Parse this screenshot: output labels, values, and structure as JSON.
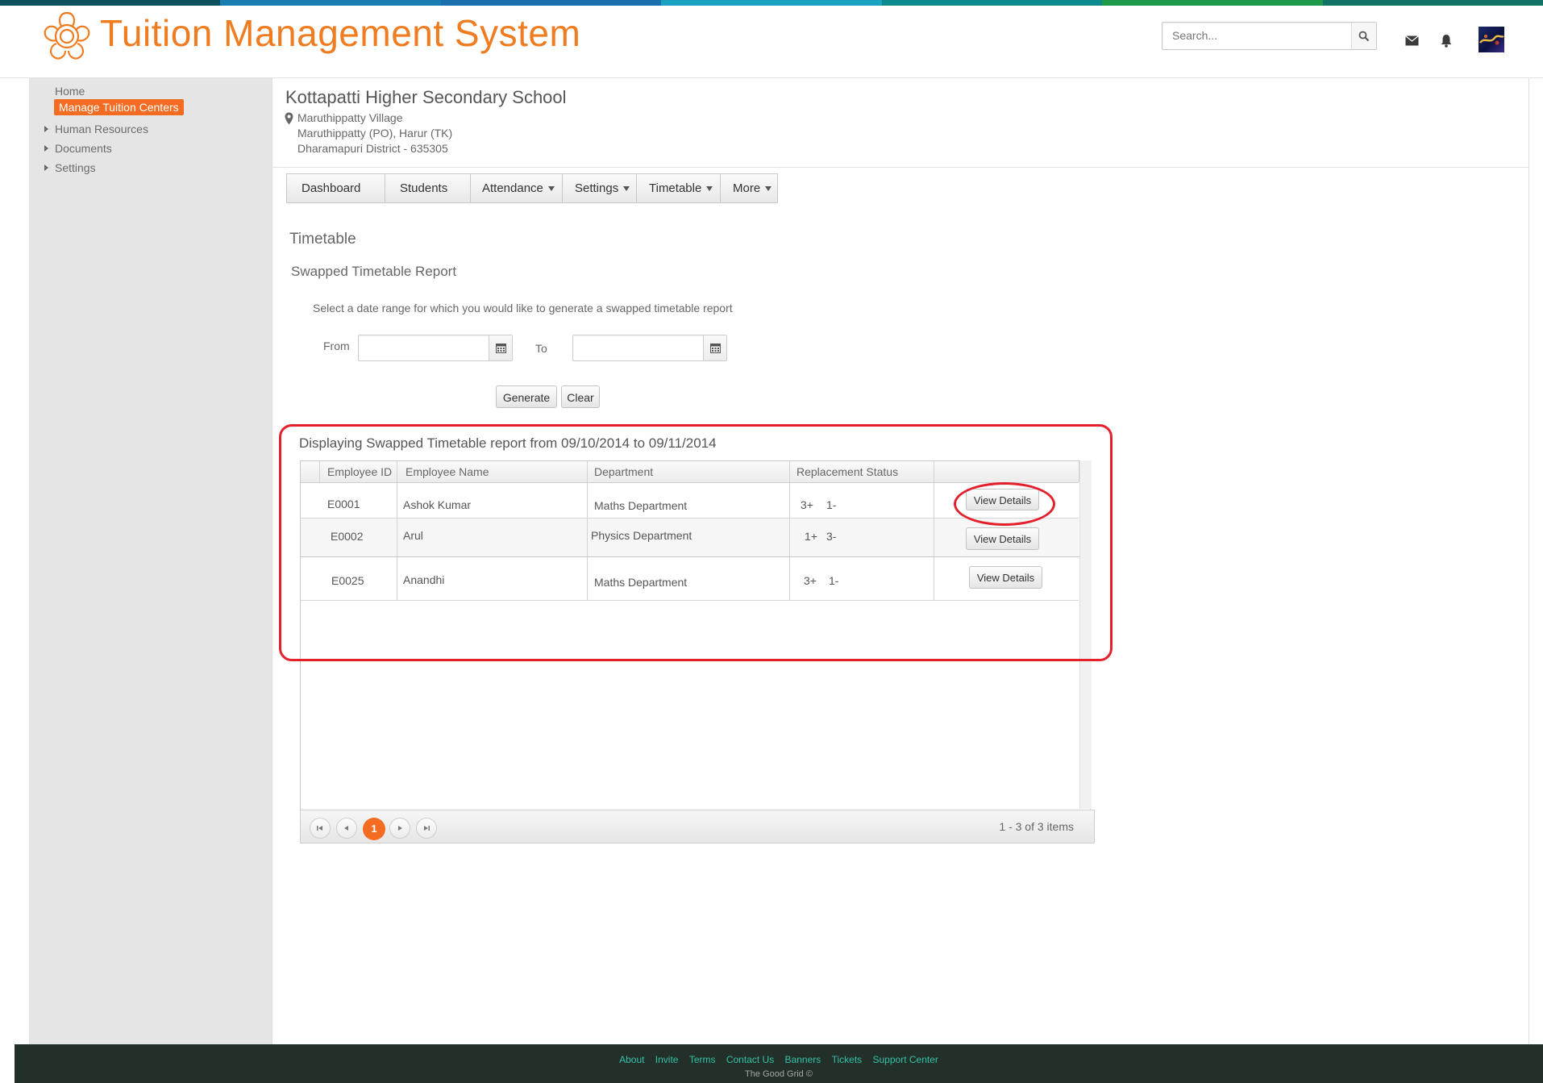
{
  "header": {
    "app_title": "Tuition Management System",
    "search_placeholder": "Search..."
  },
  "sidebar": {
    "items": [
      {
        "label": "Home"
      },
      {
        "label": "Manage Tuition  Centers"
      },
      {
        "label": "Human Resources"
      },
      {
        "label": "Documents"
      },
      {
        "label": "Settings"
      }
    ]
  },
  "school": {
    "name": "Kottapatti Higher Secondary School",
    "address": [
      "Maruthippatty Village",
      "Maruthippatty (PO), Harur (TK)",
      "Dharamapuri District - 635305"
    ]
  },
  "tabs": [
    {
      "label": "Dashboard"
    },
    {
      "label": "Students"
    },
    {
      "label": "Attendance"
    },
    {
      "label": "Settings"
    },
    {
      "label": "Timetable"
    },
    {
      "label": "More"
    }
  ],
  "page": {
    "section_title": "Timetable",
    "sub_title": "Swapped Timetable Report",
    "instructions": "Select a date range for which you would like to generate a swapped timetable report",
    "from_label": "From",
    "to_label": "To",
    "from_value": "",
    "to_value": "",
    "generate_label": "Generate",
    "clear_label": "Clear",
    "report_heading": "Displaying Swapped Timetable report from 09/10/2014 to 09/11/2014"
  },
  "grid": {
    "columns": [
      "Employee ID",
      "Employee Name",
      "Department",
      "Replacement Status"
    ],
    "rows": [
      {
        "id": "E0001",
        "name": "Ashok Kumar",
        "department": "Maths Department",
        "plus": "3+",
        "minus": "1-",
        "action": "View Details"
      },
      {
        "id": "E0002",
        "name": "Arul",
        "department": "Physics Department",
        "plus": "1+",
        "minus": "3-",
        "action": "View Details"
      },
      {
        "id": "E0025",
        "name": "Anandhi",
        "department": "Maths Department",
        "plus": "3+",
        "minus": "1-",
        "action": "View Details"
      }
    ],
    "pager": {
      "current_page": "1",
      "info": "1 - 3 of 3 items"
    }
  },
  "footer": {
    "links": [
      "About",
      "Invite",
      "Terms",
      "Contact Us",
      "Banners",
      "Tickets",
      "Support Center"
    ],
    "copyright": "The Good Grid ©"
  },
  "colors": {
    "brand_orange": "#f07c21",
    "active_orange": "#f36c21",
    "annotation_red": "#e3202b",
    "footer_bg": "#23302a",
    "footer_link": "#33c1a6"
  }
}
